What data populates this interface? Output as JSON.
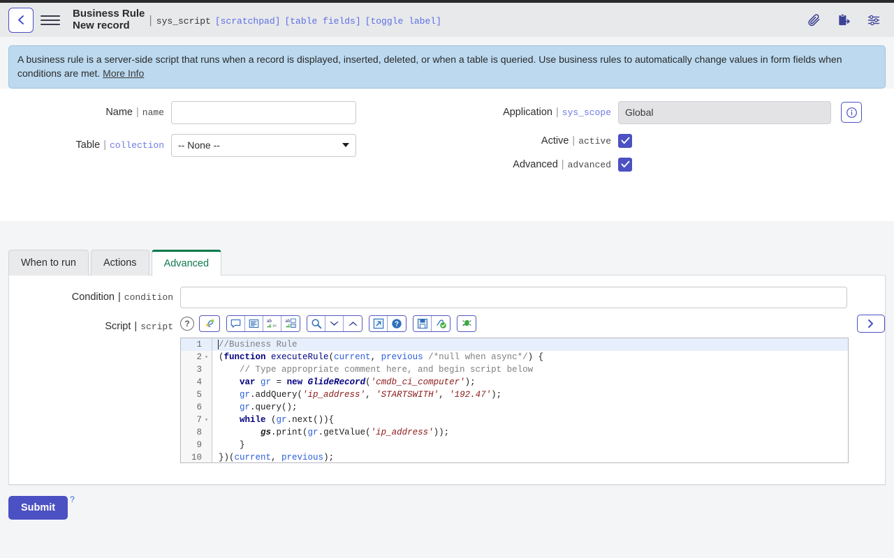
{
  "header": {
    "back_icon": "chevron-left-icon",
    "menu_icon": "hamburger-menu-icon",
    "title_line1": "Business Rule",
    "title_line2": "New record",
    "separator": "|",
    "table_name": "sys_script",
    "links": [
      "[scratchpad]",
      "[table fields]",
      "[toggle label]"
    ],
    "icons": [
      "attachment-icon",
      "template-icon",
      "personalize-form-icon"
    ]
  },
  "banner": {
    "text_before_link": "A business rule is a server-side script that runs when a record is displayed, inserted, deleted, or when a table is queried. Use business rules to automatically change values in form fields when conditions are met. ",
    "link_label": "More Info"
  },
  "form": {
    "left": [
      {
        "label": "Name",
        "sep": "|",
        "field": "name",
        "field_blue": false,
        "type": "text",
        "value": "",
        "placeholder": ""
      },
      {
        "label": "Table",
        "sep": "|",
        "field": "collection",
        "field_blue": true,
        "type": "select",
        "value": "-- None --",
        "options": [
          "-- None --"
        ]
      }
    ],
    "right": [
      {
        "label": "Application",
        "sep": "|",
        "field": "sys_scope",
        "field_blue": true,
        "type": "readonly",
        "value": "Global",
        "has_info_button": true,
        "info_icon": "info-circle-icon"
      },
      {
        "label": "Active",
        "sep": "|",
        "field": "active",
        "field_blue": false,
        "type": "checkbox",
        "checked": true
      },
      {
        "label": "Advanced",
        "sep": "|",
        "field": "advanced",
        "field_blue": false,
        "type": "checkbox",
        "checked": true
      }
    ]
  },
  "tabs": [
    {
      "label": "When to run",
      "active": false
    },
    {
      "label": "Actions",
      "active": false
    },
    {
      "label": "Advanced",
      "active": true
    }
  ],
  "advanced_tab": {
    "condition": {
      "label": "Condition",
      "sep": "|",
      "field": "condition",
      "value": "",
      "placeholder": ""
    },
    "script": {
      "label": "Script",
      "sep": "|",
      "field": "script"
    }
  },
  "editor_toolbar": {
    "help_icon": "question-circle-icon",
    "buttons": [
      {
        "name": "syntax-editor-icon",
        "group": 0
      },
      {
        "name": "comment-icon",
        "group": 1
      },
      {
        "name": "format-code-icon",
        "group": 1
      },
      {
        "name": "replace-icon",
        "group": 1
      },
      {
        "name": "replace-all-icon",
        "group": 1
      },
      {
        "name": "search-icon",
        "group": 2
      },
      {
        "name": "find-next-icon",
        "group": 2
      },
      {
        "name": "find-previous-icon",
        "group": 2
      },
      {
        "name": "fullscreen-icon",
        "group": 3
      },
      {
        "name": "help-icon",
        "group": 3
      },
      {
        "name": "save-icon",
        "group": 4
      },
      {
        "name": "syntax-check-icon",
        "group": 4
      },
      {
        "name": "debug-icon",
        "group": 5
      }
    ],
    "expand_icon": "chevron-right-icon"
  },
  "code": {
    "active_line": 1,
    "lines": [
      {
        "n": "1",
        "fold": false,
        "tokens": [
          {
            "t": "//Business Rule",
            "c": "cm"
          }
        ]
      },
      {
        "n": "2",
        "fold": true,
        "tokens": [
          {
            "t": "(",
            "c": ""
          },
          {
            "t": "function",
            "c": "kw"
          },
          {
            "t": " ",
            "c": ""
          },
          {
            "t": "executeRule",
            "c": "fn"
          },
          {
            "t": "(",
            "c": ""
          },
          {
            "t": "current",
            "c": "vr"
          },
          {
            "t": ", ",
            "c": ""
          },
          {
            "t": "previous",
            "c": "vr"
          },
          {
            "t": " ",
            "c": ""
          },
          {
            "t": "/*null when async*/",
            "c": "cm"
          },
          {
            "t": ") {",
            "c": ""
          }
        ]
      },
      {
        "n": "3",
        "fold": false,
        "tokens": [
          {
            "t": "    // Type appropriate comment here, and begin script below",
            "c": "cm"
          }
        ]
      },
      {
        "n": "4",
        "fold": false,
        "tokens": [
          {
            "t": "    ",
            "c": ""
          },
          {
            "t": "var",
            "c": "kw"
          },
          {
            "t": " ",
            "c": ""
          },
          {
            "t": "gr",
            "c": "vr"
          },
          {
            "t": " = ",
            "c": ""
          },
          {
            "t": "new",
            "c": "kw"
          },
          {
            "t": " ",
            "c": ""
          },
          {
            "t": "GlideRecord",
            "c": "cls"
          },
          {
            "t": "(",
            "c": ""
          },
          {
            "t": "'cmdb_ci_computer'",
            "c": "str"
          },
          {
            "t": ");",
            "c": ""
          }
        ]
      },
      {
        "n": "5",
        "fold": false,
        "tokens": [
          {
            "t": "    ",
            "c": ""
          },
          {
            "t": "gr",
            "c": "vr"
          },
          {
            "t": ".addQuery(",
            "c": ""
          },
          {
            "t": "'ip_address'",
            "c": "str"
          },
          {
            "t": ", ",
            "c": ""
          },
          {
            "t": "'STARTSWITH'",
            "c": "str"
          },
          {
            "t": ", ",
            "c": ""
          },
          {
            "t": "'192.47'",
            "c": "str"
          },
          {
            "t": ");",
            "c": ""
          }
        ]
      },
      {
        "n": "6",
        "fold": false,
        "tokens": [
          {
            "t": "    ",
            "c": ""
          },
          {
            "t": "gr",
            "c": "vr"
          },
          {
            "t": ".query();",
            "c": ""
          }
        ]
      },
      {
        "n": "7",
        "fold": true,
        "tokens": [
          {
            "t": "    ",
            "c": ""
          },
          {
            "t": "while",
            "c": "kw"
          },
          {
            "t": " (",
            "c": ""
          },
          {
            "t": "gr",
            "c": "vr"
          },
          {
            "t": ".next()){",
            "c": ""
          }
        ]
      },
      {
        "n": "8",
        "fold": false,
        "tokens": [
          {
            "t": "        ",
            "c": ""
          },
          {
            "t": "gs",
            "c": "gs"
          },
          {
            "t": ".print(",
            "c": ""
          },
          {
            "t": "gr",
            "c": "vr"
          },
          {
            "t": ".getValue(",
            "c": ""
          },
          {
            "t": "'ip_address'",
            "c": "str"
          },
          {
            "t": "));",
            "c": ""
          }
        ]
      },
      {
        "n": "9",
        "fold": false,
        "tokens": [
          {
            "t": "    }",
            "c": ""
          }
        ]
      },
      {
        "n": "10",
        "fold": false,
        "tokens": [
          {
            "t": "})(",
            "c": ""
          },
          {
            "t": "current",
            "c": "vr"
          },
          {
            "t": ", ",
            "c": ""
          },
          {
            "t": "previous",
            "c": "vr"
          },
          {
            "t": ");",
            "c": ""
          }
        ]
      }
    ]
  },
  "footer": {
    "submit_label": "Submit",
    "help_label": "?"
  },
  "colors": {
    "accent": "#4b50c2",
    "banner_bg": "#bcd9ef",
    "active_tab": "#067a4b",
    "link": "#5b6ee4",
    "page_bg": "#f4f5f7"
  }
}
